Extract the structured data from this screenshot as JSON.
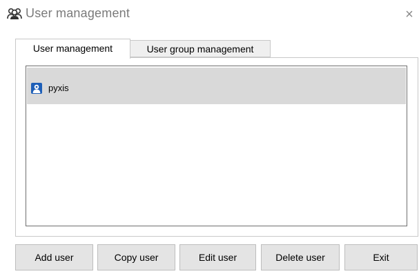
{
  "window": {
    "title": "User management",
    "title_icon": "users-icon",
    "close_symbol": "×"
  },
  "tabs": [
    {
      "label": "User management",
      "active": true
    },
    {
      "label": "User group management",
      "active": false
    }
  ],
  "user_list": {
    "items": [
      {
        "name": "pyxis",
        "icon": "user-icon",
        "selected": true
      }
    ]
  },
  "buttons": {
    "add_user": "Add user",
    "copy_user": "Copy user",
    "edit_user": "Edit user",
    "delete_user": "Delete user",
    "exit": "Exit"
  },
  "colors": {
    "selection": "#d9d9d9",
    "button_bg": "#e4e4e4",
    "title_text": "#7a7a7a"
  }
}
